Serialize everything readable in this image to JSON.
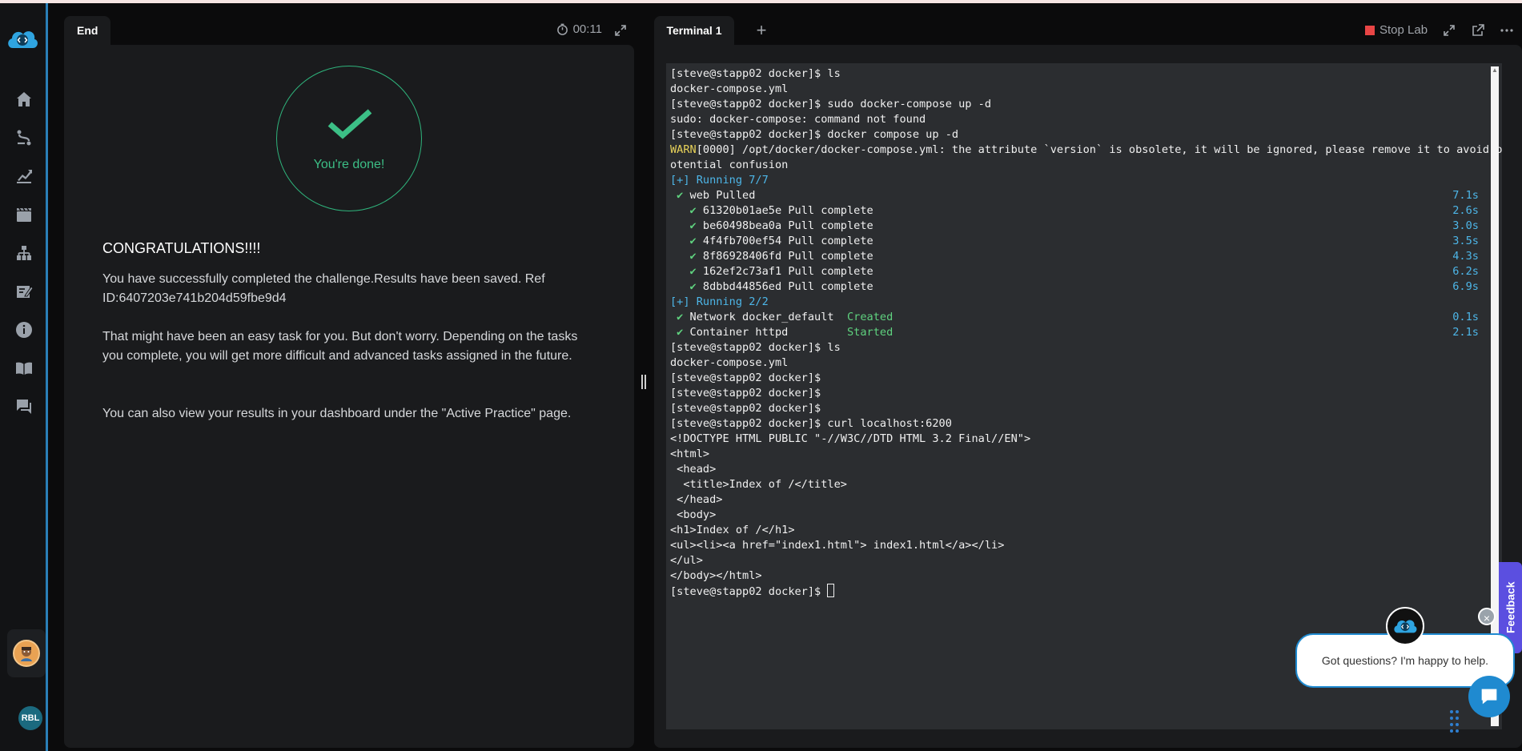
{
  "sidebar": {
    "items": [
      {
        "name": "home-icon"
      },
      {
        "name": "path-icon"
      },
      {
        "name": "chart-icon"
      },
      {
        "name": "film-icon"
      },
      {
        "name": "hierarchy-icon"
      },
      {
        "name": "edit-note-icon"
      },
      {
        "name": "info-icon"
      },
      {
        "name": "book-icon"
      },
      {
        "name": "chat-icon"
      }
    ],
    "user_initials": "RBL"
  },
  "left": {
    "tab_label": "End",
    "timer": "00:11",
    "done_label": "You're done!",
    "congrats": "CONGRATULATIONS!!!!",
    "para1": "You have successfully completed the challenge.Results have been saved. Ref ID:6407203e741b204d59fbe9d4",
    "para2": "That might have been an easy task for you. But don't worry. Depending on the tasks you complete, you will get more difficult and advanced tasks assigned in the future.",
    "para3": "You can also view your results in your dashboard under the \"Active Practice\" page."
  },
  "right": {
    "tab_label": "Terminal 1",
    "add_tab": "+",
    "stop_lab": "Stop Lab"
  },
  "terminal": {
    "lines": [
      {
        "text": "[steve@stapp02 docker]$ ls"
      },
      {
        "text": "docker-compose.yml"
      },
      {
        "text": "[steve@stapp02 docker]$ sudo docker-compose up -d"
      },
      {
        "text": "sudo: docker-compose: command not found"
      },
      {
        "text": "[steve@stapp02 docker]$ docker compose up -d"
      },
      {
        "warn": "WARN",
        "text": "[0000] /opt/docker/docker-compose.yml: the attribute `version` is obsolete, it will be ignored, please remove it to avoid p"
      },
      {
        "text": "otential confusion"
      },
      {
        "blue": "[+] Running 7/7"
      },
      {
        "check": " ✔",
        "text": " web Pulled",
        "time": "7.1s"
      },
      {
        "check": "   ✔",
        "text": " 61320b01ae5e Pull complete",
        "time": "2.6s"
      },
      {
        "check": "   ✔",
        "text": " be60498bea0a Pull complete",
        "time": "3.0s"
      },
      {
        "check": "   ✔",
        "text": " 4f4fb700ef54 Pull complete",
        "time": "3.5s"
      },
      {
        "check": "   ✔",
        "text": " 8f86928406fd Pull complete",
        "time": "4.3s"
      },
      {
        "check": "   ✔",
        "text": " 162ef2c73af1 Pull complete",
        "time": "6.2s"
      },
      {
        "check": "   ✔",
        "text": " 8dbbd44856ed Pull complete",
        "time": "6.9s"
      },
      {
        "blue": "[+] Running 2/2"
      },
      {
        "check": " ✔",
        "text": " Network docker_default  ",
        "status": "Created",
        "time": "0.1s"
      },
      {
        "check": " ✔",
        "text": " Container httpd         ",
        "status": "Started",
        "time": "2.1s"
      },
      {
        "text": "[steve@stapp02 docker]$ ls"
      },
      {
        "text": "docker-compose.yml"
      },
      {
        "text": "[steve@stapp02 docker]$"
      },
      {
        "text": "[steve@stapp02 docker]$"
      },
      {
        "text": "[steve@stapp02 docker]$"
      },
      {
        "text": "[steve@stapp02 docker]$ curl localhost:6200"
      },
      {
        "text": "<!DOCTYPE HTML PUBLIC \"-//W3C//DTD HTML 3.2 Final//EN\">"
      },
      {
        "text": "<html>"
      },
      {
        "text": " <head>"
      },
      {
        "text": "  <title>Index of /</title>"
      },
      {
        "text": " </head>"
      },
      {
        "text": " <body>"
      },
      {
        "text": "<h1>Index of /</h1>"
      },
      {
        "text": "<ul><li><a href=\"index1.html\"> index1.html</a></li>"
      },
      {
        "text": "</ul>"
      },
      {
        "text": "</body></html>"
      },
      {
        "text": "[steve@stapp02 docker]$ ",
        "cursor": true
      }
    ]
  },
  "chat": {
    "message": "Got questions? I'm happy to help.",
    "close": "×",
    "feedback": "Feedback"
  },
  "colors": {
    "accent": "#2a7fb8",
    "success": "#3cbf86",
    "terminal_bg": "#2b2d30",
    "warn": "#e8d35a",
    "info": "#4db6e8"
  }
}
